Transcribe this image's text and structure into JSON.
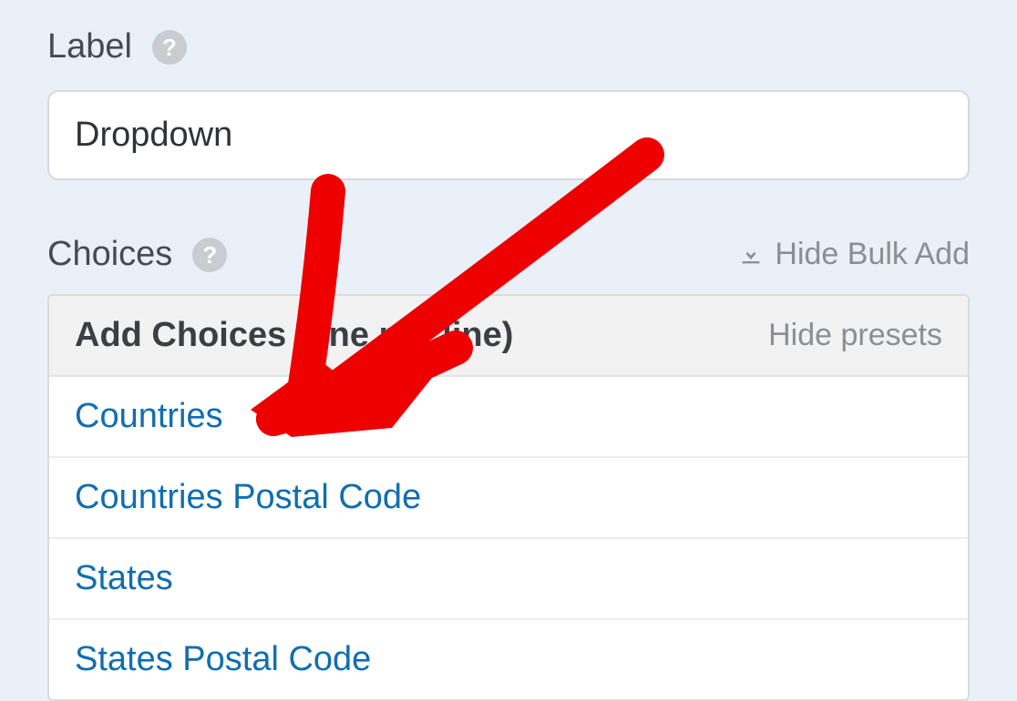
{
  "label": {
    "text": "Label",
    "input_value": "Dropdown"
  },
  "choices": {
    "text": "Choices",
    "bulk_toggle": "Hide Bulk Add",
    "panel_title": "Add Choices (one per line)",
    "hide_presets": "Hide presets",
    "presets": [
      "Countries",
      "Countries Postal Code",
      "States",
      "States Postal Code"
    ]
  }
}
